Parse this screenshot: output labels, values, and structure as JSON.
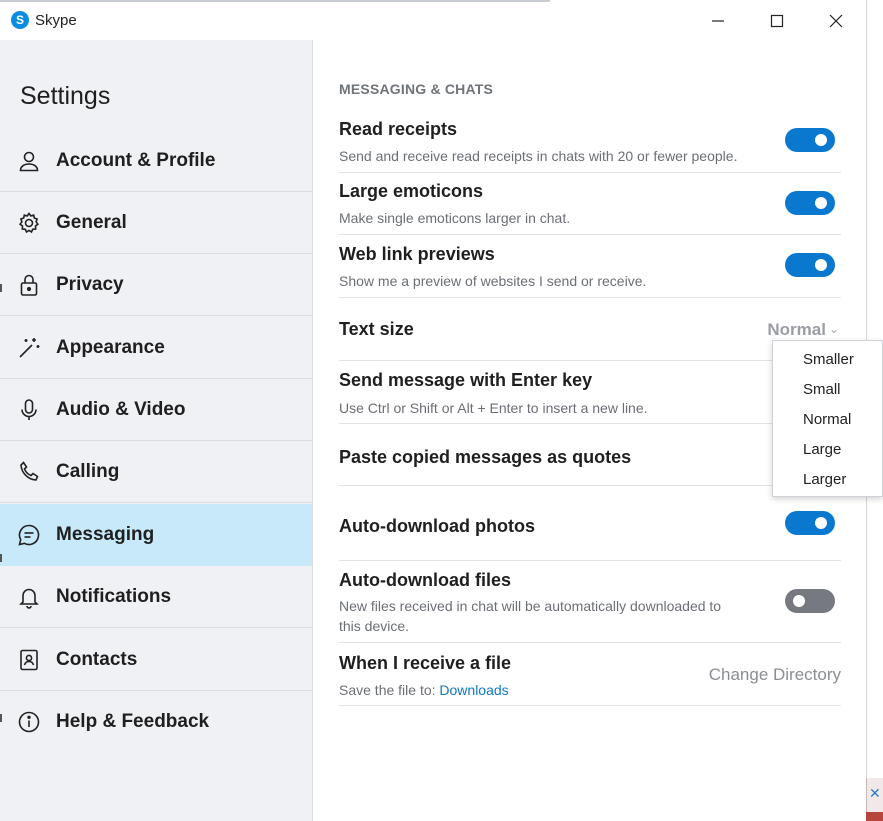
{
  "window": {
    "title": "Skype",
    "logo_letter": "S"
  },
  "sidebar": {
    "heading": "Settings",
    "items": [
      {
        "label": "Account & Profile",
        "icon": "person-icon"
      },
      {
        "label": "General",
        "icon": "gear-icon"
      },
      {
        "label": "Privacy",
        "icon": "lock-icon"
      },
      {
        "label": "Appearance",
        "icon": "magic-wand-icon"
      },
      {
        "label": "Audio & Video",
        "icon": "microphone-icon"
      },
      {
        "label": "Calling",
        "icon": "phone-icon"
      },
      {
        "label": "Messaging",
        "icon": "chat-bubble-icon",
        "active": true
      },
      {
        "label": "Notifications",
        "icon": "bell-icon"
      },
      {
        "label": "Contacts",
        "icon": "contacts-book-icon"
      },
      {
        "label": "Help & Feedback",
        "icon": "info-icon"
      }
    ]
  },
  "main": {
    "section_title": "MESSAGING & CHATS",
    "settings": {
      "read_receipts": {
        "title": "Read receipts",
        "desc": "Send and receive read receipts in chats with 20 or fewer people.",
        "enabled": true
      },
      "large_emoticons": {
        "title": "Large emoticons",
        "desc": "Make single emoticons larger in chat.",
        "enabled": true
      },
      "web_link_previews": {
        "title": "Web link previews",
        "desc": "Show me a preview of websites I send or receive.",
        "enabled": true
      },
      "text_size": {
        "title": "Text size",
        "value": "Normal"
      },
      "send_with_enter": {
        "title": "Send message with Enter key",
        "desc": "Use Ctrl or Shift or Alt + Enter to insert a new line."
      },
      "paste_as_quotes": {
        "title": "Paste copied messages as quotes"
      },
      "auto_download_photos": {
        "title": "Auto-download photos",
        "enabled": true
      },
      "auto_download_files": {
        "title": "Auto-download files",
        "desc_line1": "New files received in chat will be automatically downloaded to",
        "desc_line2": "this device.",
        "enabled": false
      },
      "receive_file": {
        "title": "When I receive a file",
        "desc_prefix": "Save the file to:",
        "link": "Downloads",
        "action": "Change Directory"
      }
    }
  },
  "text_size_menu": {
    "options": [
      "Smaller",
      "Small",
      "Normal",
      "Large",
      "Larger"
    ]
  },
  "colors": {
    "accent": "#0b78cf",
    "active_nav": "#c7e9f9",
    "sidebar_bg": "#f0f1f5",
    "toggle_off": "#767a80",
    "link": "#0f7ac6"
  }
}
